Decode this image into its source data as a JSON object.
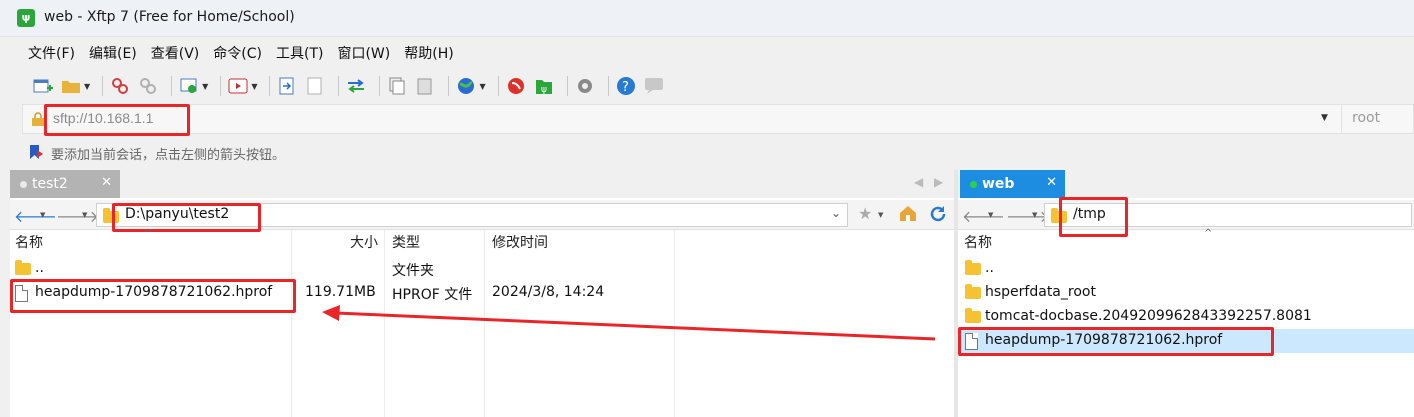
{
  "window": {
    "title": "web - Xftp 7 (Free for Home/School)",
    "icon": "xftp-app-icon"
  },
  "menu": [
    "文件(F)",
    "编辑(E)",
    "查看(V)",
    "命令(C)",
    "工具(T)",
    "窗口(W)",
    "帮助(H)"
  ],
  "address": {
    "value": "sftp://10.168.1.1",
    "user": "root"
  },
  "hint": "要添加当前会话，点击左侧的箭头按钮。",
  "left": {
    "tab_label": "test2",
    "path": "D:\\panyu\\test2",
    "columns": {
      "name": "名称",
      "size": "大小",
      "type": "类型",
      "modified": "修改时间"
    },
    "rows": [
      {
        "name": "..",
        "size": "",
        "type": "文件夹",
        "modified": "",
        "kind": "folder"
      },
      {
        "name": "heapdump-1709878721062.hprof",
        "size": "119.71MB",
        "type": "HPROF 文件",
        "modified": "2024/3/8, 14:24",
        "kind": "file"
      }
    ]
  },
  "right": {
    "tab_label": "web",
    "path": "/tmp",
    "columns": {
      "name": "名称"
    },
    "rows": [
      {
        "name": "..",
        "kind": "folder"
      },
      {
        "name": "hsperfdata_root",
        "kind": "folder"
      },
      {
        "name": "tomcat-docbase.2049209962843392257.8081",
        "kind": "folder"
      },
      {
        "name": "heapdump-1709878721062.hprof",
        "kind": "file",
        "selected": true
      }
    ]
  },
  "colors": {
    "accent": "#1c8de0",
    "annotation": "#e8262a",
    "selected_row": "#cce8ff"
  }
}
